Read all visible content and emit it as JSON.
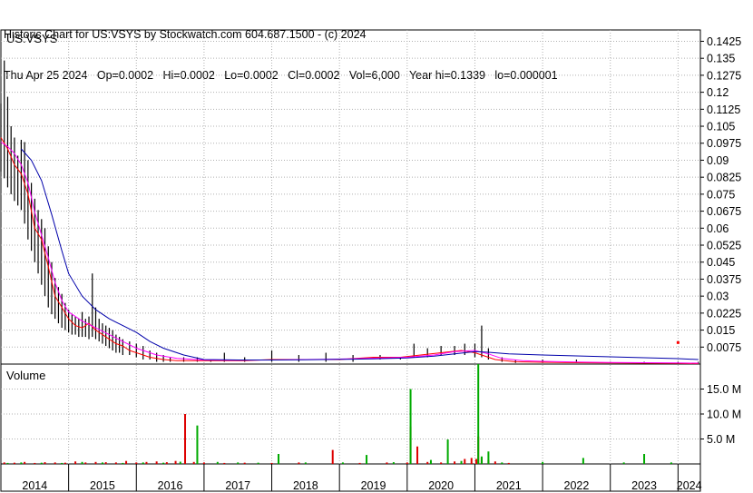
{
  "header": {
    "line1": "Historic Chart for US:VSYS by Stockwatch.com 604.687.1500 - (c) 2024",
    "line2": "Thu Apr 25 2024   Op=0.0002   Hi=0.0002   Lo=0.0002   Cl=0.0002   Vol=6,000   Year hi=0.1339   lo=0.000001"
  },
  "chart_data": [
    {
      "type": "line",
      "title": "US:VSYS",
      "ylim": [
        0,
        0.1475
      ],
      "yticks": [
        "0.1425",
        "0.135",
        "0.1275",
        "0.12",
        "0.1125",
        "0.105",
        "0.0975",
        "0.09",
        "0.0825",
        "0.075",
        "0.0675",
        "0.06",
        "0.0525",
        "0.045",
        "0.0375",
        "0.03",
        "0.0225",
        "0.015",
        "0.0075"
      ],
      "ytick_values": [
        0.1425,
        0.135,
        0.1275,
        0.12,
        0.1125,
        0.105,
        0.0975,
        0.09,
        0.0825,
        0.075,
        0.0675,
        0.06,
        0.0525,
        0.045,
        0.0375,
        0.03,
        0.0225,
        0.015,
        0.0075
      ],
      "x_years": [
        "2014",
        "2015",
        "2016",
        "2017",
        "2018",
        "2019",
        "2020",
        "2021",
        "2022",
        "2023",
        "2024"
      ],
      "x_range": [
        2014.0,
        2024.33
      ],
      "grid": true,
      "series": [
        {
          "role": "high-low bars",
          "color": "#000000",
          "x": [
            2014.0,
            2014.05,
            2014.1,
            2014.15,
            2014.2,
            2014.25,
            2014.3,
            2014.35,
            2014.4,
            2014.45,
            2014.5,
            2014.55,
            2014.6,
            2014.65,
            2014.7,
            2014.75,
            2014.8,
            2014.85,
            2014.9,
            2014.95,
            2015.0,
            2015.05,
            2015.1,
            2015.15,
            2015.2,
            2015.25,
            2015.3,
            2015.35,
            2015.4,
            2015.45,
            2015.5,
            2015.55,
            2015.6,
            2015.65,
            2015.7,
            2015.75,
            2015.8,
            2015.9,
            2016.0,
            2016.1,
            2016.2,
            2016.3,
            2016.4,
            2016.5,
            2016.7,
            2016.9,
            2017.1,
            2017.3,
            2017.6,
            2018.0,
            2018.4,
            2018.8,
            2019.2,
            2019.6,
            2019.9,
            2020.1,
            2020.3,
            2020.5,
            2020.7,
            2020.85,
            2021.0,
            2021.1,
            2021.2,
            2021.4,
            2021.6,
            2022.0,
            2022.5,
            2023.0,
            2023.5,
            2024.0,
            2024.3
          ],
          "high": [
            0.115,
            0.134,
            0.118,
            0.105,
            0.1,
            0.092,
            0.099,
            0.098,
            0.09,
            0.08,
            0.073,
            0.068,
            0.064,
            0.06,
            0.052,
            0.045,
            0.038,
            0.034,
            0.031,
            0.027,
            0.024,
            0.022,
            0.021,
            0.02,
            0.023,
            0.02,
            0.021,
            0.04,
            0.025,
            0.02,
            0.018,
            0.017,
            0.016,
            0.015,
            0.013,
            0.012,
            0.011,
            0.01,
            0.009,
            0.008,
            0.006,
            0.005,
            0.004,
            0.003,
            0.003,
            0.003,
            0.002,
            0.005,
            0.003,
            0.006,
            0.004,
            0.005,
            0.004,
            0.004,
            0.003,
            0.009,
            0.007,
            0.008,
            0.008,
            0.009,
            0.009,
            0.017,
            0.007,
            0.003,
            0.002,
            0.002,
            0.002,
            0.001,
            0.001,
            0.001,
            0.001
          ],
          "low": [
            0.085,
            0.082,
            0.078,
            0.075,
            0.072,
            0.07,
            0.068,
            0.062,
            0.055,
            0.05,
            0.045,
            0.04,
            0.035,
            0.03,
            0.025,
            0.022,
            0.02,
            0.018,
            0.016,
            0.015,
            0.014,
            0.013,
            0.013,
            0.012,
            0.012,
            0.012,
            0.011,
            0.012,
            0.011,
            0.01,
            0.009,
            0.008,
            0.007,
            0.006,
            0.005,
            0.005,
            0.004,
            0.004,
            0.003,
            0.002,
            0.002,
            0.001,
            0.001,
            0.001,
            0.001,
            0.001,
            0.001,
            0.001,
            0.001,
            0.001,
            0.001,
            0.001,
            0.001,
            0.002,
            0.002,
            0.003,
            0.003,
            0.004,
            0.004,
            0.004,
            0.003,
            0.003,
            0.002,
            0.001,
            0.0005,
            0.0005,
            0.0005,
            0.0004,
            0.0003,
            0.0002,
            0.0002
          ]
        },
        {
          "role": "close",
          "color": "#ff0000",
          "x": [
            2014.0,
            2014.1,
            2014.2,
            2014.3,
            2014.4,
            2014.5,
            2014.6,
            2014.7,
            2014.8,
            2014.9,
            2015.0,
            2015.1,
            2015.2,
            2015.3,
            2015.4,
            2015.5,
            2015.6,
            2015.7,
            2015.8,
            2015.9,
            2016.0,
            2016.2,
            2016.4,
            2016.6,
            2016.9,
            2017.2,
            2017.6,
            2018.0,
            2018.5,
            2019.0,
            2019.5,
            2019.9,
            2020.2,
            2020.5,
            2020.8,
            2021.0,
            2021.1,
            2021.3,
            2021.6,
            2022.0,
            2022.5,
            2023.0,
            2023.5,
            2024.0,
            2024.3
          ],
          "values": [
            0.1,
            0.095,
            0.088,
            0.084,
            0.075,
            0.06,
            0.055,
            0.043,
            0.03,
            0.025,
            0.02,
            0.017,
            0.016,
            0.018,
            0.015,
            0.013,
            0.011,
            0.009,
            0.008,
            0.006,
            0.005,
            0.003,
            0.002,
            0.0015,
            0.0015,
            0.0015,
            0.0015,
            0.002,
            0.002,
            0.002,
            0.003,
            0.003,
            0.004,
            0.005,
            0.006,
            0.005,
            0.004,
            0.002,
            0.001,
            0.0008,
            0.0006,
            0.0005,
            0.0004,
            0.0003,
            0.0002
          ],
          "outlier": {
            "x": 2024.0,
            "y": 0.0095
          }
        },
        {
          "role": "moving average (short)",
          "color": "#ff00ff",
          "x": [
            2014.0,
            2014.1,
            2014.2,
            2014.3,
            2014.4,
            2014.5,
            2014.6,
            2014.7,
            2014.8,
            2014.9,
            2015.0,
            2015.2,
            2015.4,
            2015.6,
            2015.8,
            2016.0,
            2016.3,
            2016.6,
            2017.0,
            2017.5,
            2018.0,
            2018.5,
            2019.0,
            2019.5,
            2020.0,
            2020.4,
            2020.7,
            2021.0,
            2021.2,
            2021.4,
            2021.7,
            2022.0,
            2022.5,
            2023.0,
            2023.5,
            2024.0,
            2024.3
          ],
          "values": [
            0.098,
            0.096,
            0.093,
            0.088,
            0.08,
            0.067,
            0.057,
            0.047,
            0.036,
            0.028,
            0.023,
            0.019,
            0.016,
            0.013,
            0.01,
            0.007,
            0.004,
            0.0025,
            0.0018,
            0.0017,
            0.0018,
            0.002,
            0.0022,
            0.0026,
            0.003,
            0.004,
            0.0055,
            0.006,
            0.0045,
            0.0025,
            0.0015,
            0.0012,
            0.0009,
            0.0007,
            0.0006,
            0.0005,
            0.0004
          ]
        },
        {
          "role": "moving average (long)",
          "color": "#0000aa",
          "x": [
            2014.3,
            2014.45,
            2014.6,
            2014.75,
            2014.9,
            2015.0,
            2015.2,
            2015.4,
            2015.6,
            2015.8,
            2016.0,
            2016.2,
            2016.4,
            2016.7,
            2017.0,
            2017.5,
            2018.0,
            2018.5,
            2019.0,
            2019.5,
            2020.0,
            2020.4,
            2020.7,
            2021.0,
            2021.2,
            2021.5,
            2022.0,
            2022.5,
            2023.0,
            2023.5,
            2024.0,
            2024.3
          ],
          "values": [
            0.095,
            0.09,
            0.081,
            0.066,
            0.05,
            0.04,
            0.03,
            0.024,
            0.02,
            0.017,
            0.014,
            0.01,
            0.007,
            0.004,
            0.002,
            0.0018,
            0.0018,
            0.0019,
            0.0021,
            0.0023,
            0.0027,
            0.0035,
            0.0045,
            0.0055,
            0.0052,
            0.0045,
            0.004,
            0.0036,
            0.0032,
            0.0028,
            0.0024,
            0.002
          ]
        }
      ]
    },
    {
      "type": "bar",
      "title": "Volume",
      "ylim": [
        0,
        20000000
      ],
      "yticks": [
        "15.0 M",
        "10.0 M",
        "5.0 M"
      ],
      "ytick_values": [
        15000000,
        10000000,
        5000000
      ],
      "x_range": [
        2014.0,
        2024.33
      ],
      "grid": true,
      "series": [
        {
          "name": "down",
          "color": "#dd0000",
          "x": [
            2014.05,
            2014.2,
            2014.35,
            2014.5,
            2014.65,
            2014.8,
            2014.95,
            2015.1,
            2015.25,
            2015.4,
            2015.55,
            2015.7,
            2015.85,
            2016.0,
            2016.15,
            2016.3,
            2016.45,
            2016.58,
            2016.72,
            2016.85,
            2017.0,
            2017.3,
            2017.6,
            2018.0,
            2018.4,
            2018.9,
            2019.3,
            2019.7,
            2020.0,
            2020.05,
            2020.15,
            2020.3,
            2020.5,
            2020.7,
            2020.85,
            2020.95,
            2021.02,
            2021.05,
            2021.1,
            2021.2,
            2021.3,
            2021.5
          ],
          "values": [
            300000,
            250000,
            400000,
            200000,
            350000,
            300000,
            250000,
            500000,
            300000,
            400000,
            350000,
            300000,
            600000,
            300000,
            400000,
            500000,
            350000,
            600000,
            10000000,
            400000,
            300000,
            200000,
            250000,
            200000,
            300000,
            2800000,
            200000,
            300000,
            300000,
            7500000,
            3500000,
            400000,
            300000,
            500000,
            1000000,
            1200000,
            1000000,
            5500000,
            1200000,
            800000,
            500000,
            200000
          ]
        },
        {
          "name": "up",
          "color": "#00aa00",
          "x": [
            2014.1,
            2014.3,
            2014.6,
            2014.9,
            2015.2,
            2015.5,
            2015.8,
            2016.1,
            2016.4,
            2016.65,
            2016.9,
            2017.2,
            2017.5,
            2017.8,
            2018.1,
            2018.5,
            2019.05,
            2019.4,
            2019.8,
            2020.05,
            2020.35,
            2020.6,
            2020.8,
            2021.05,
            2021.1,
            2021.2,
            2021.4,
            2022.0,
            2022.6,
            2023.2,
            2023.5,
            2023.9
          ],
          "values": [
            200000,
            300000,
            250000,
            200000,
            400000,
            300000,
            200000,
            300000,
            250000,
            450000,
            7700000,
            400000,
            300000,
            250000,
            2000000,
            300000,
            300000,
            1800000,
            350000,
            15000000,
            800000,
            4900000,
            600000,
            20000000,
            1500000,
            2500000,
            300000,
            400000,
            1200000,
            300000,
            2000000,
            300000
          ]
        }
      ]
    }
  ]
}
